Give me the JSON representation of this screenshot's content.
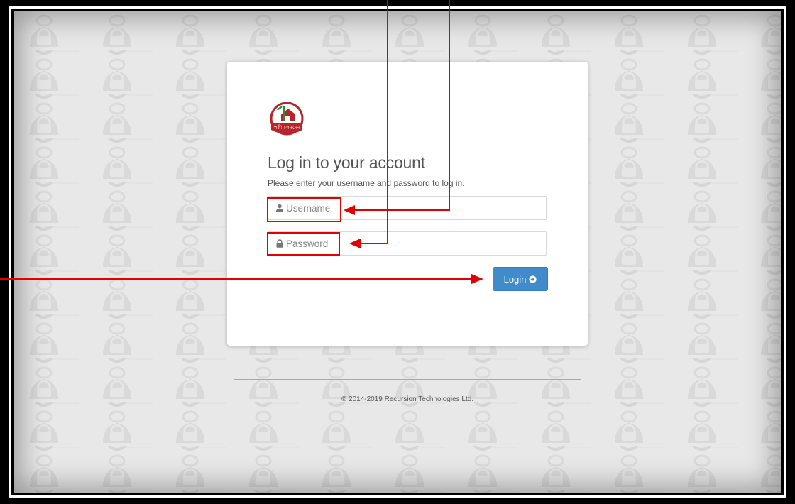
{
  "login": {
    "title": "Log in to your account",
    "subtitle": "Please enter your username and password to log in.",
    "username": {
      "placeholder": "Username",
      "value": "",
      "icon": "user-icon"
    },
    "password": {
      "placeholder": "Password",
      "value": "",
      "icon": "lock-icon"
    },
    "button": {
      "label": "Login",
      "icon": "arrow-circle-right-icon"
    }
  },
  "brand": {
    "logo": "palli-lenden-logo",
    "logo_text": "পল্লী লেনদেন"
  },
  "footer": {
    "copyright": "© 2014-2019 Recursion Technologies Ltd."
  },
  "colors": {
    "button": "#428bca",
    "annotation": "#e00000",
    "background": "#e9e9e9",
    "logo_red": "#b5252b",
    "logo_green": "#2a8a3a"
  }
}
